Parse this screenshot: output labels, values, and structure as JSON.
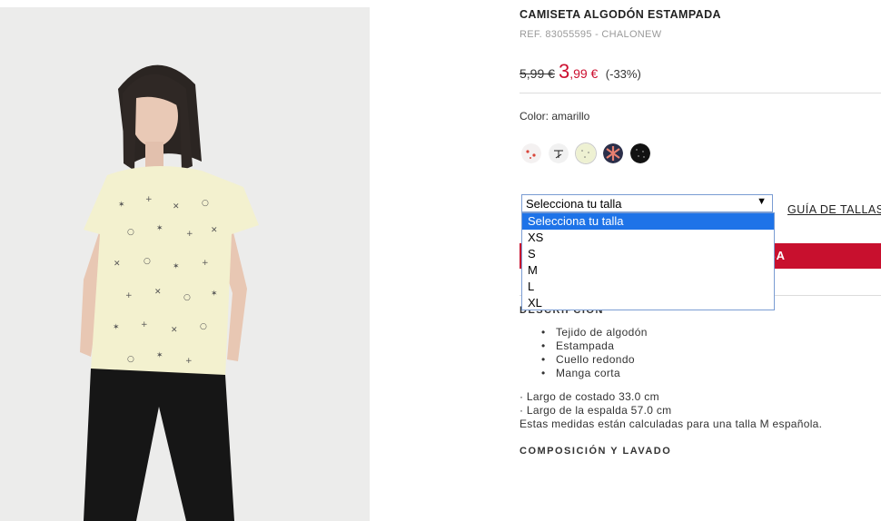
{
  "product": {
    "title": "CAMISETA ALGODÓN ESTAMPADA",
    "ref": "REF. 83055595 - CHALONEW",
    "price_old": "5,99 €",
    "price_new_int": "3",
    "price_new_dec": ",99 €",
    "discount": "(-33%)"
  },
  "color": {
    "label": "Color: amarillo",
    "swatches": [
      "white-red-print",
      "white-black-print",
      "yellow-print",
      "navy-coral-print",
      "black-dots-print"
    ],
    "selected_index": 2
  },
  "size": {
    "selected": "Selecciona tu talla",
    "options": [
      "Selecciona tu talla",
      "XS",
      "S",
      "M",
      "L",
      "XL"
    ],
    "guide_label": "GUÍA DE TALLAS"
  },
  "add_to_bag": {
    "label_visible": "LSA"
  },
  "description": {
    "heading": "DESCRIPCIÓN",
    "bullets": [
      "Tejido de algodón",
      "Estampada",
      "Cuello redondo",
      "Manga corta"
    ],
    "measures": [
      "· Largo de costado 33.0 cm",
      "· Largo de la espalda 57.0 cm",
      "Estas medidas están calculadas para una talla M española."
    ]
  },
  "composition": {
    "heading": "COMPOSICIÓN Y LAVADO"
  },
  "colors": {
    "accent": "#c8102e",
    "price": "#cc0f2f",
    "highlight": "#1e73e8"
  }
}
